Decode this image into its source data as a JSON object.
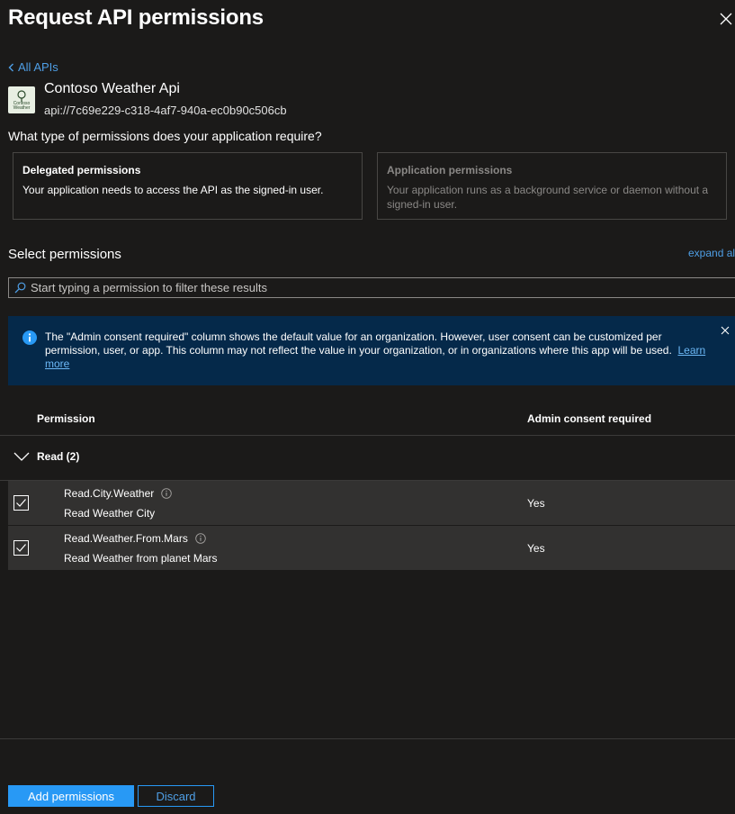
{
  "panel": {
    "title": "Request API permissions"
  },
  "nav": {
    "back_label": "All APIs"
  },
  "api": {
    "logo_text": "Contoso Weather",
    "name": "Contoso Weather Api",
    "id": "api://7c69e229-c318-4af7-940a-ec0b90c506cb"
  },
  "permission_type": {
    "question": "What type of permissions does your application require?",
    "delegated": {
      "title": "Delegated permissions",
      "description": "Your application needs to access the API as the signed-in user."
    },
    "application": {
      "title": "Application permissions",
      "description": "Your application runs as a background service or daemon without a signed-in user."
    }
  },
  "select": {
    "label": "Select permissions",
    "expand_label": "expand all",
    "filter_placeholder": "Start typing a permission to filter these results"
  },
  "banner": {
    "text": "The \"Admin consent required\" column shows the default value for an organization. However, user consent can be customized per permission, user, or app. This column may not reflect the value in your organization, or in organizations where this app will be used.",
    "link": "Learn more"
  },
  "table": {
    "headers": {
      "permission": "Permission",
      "admin_consent": "Admin consent required"
    },
    "group": {
      "label": "Read (2)"
    },
    "rows": [
      {
        "name": "Read.City.Weather",
        "description": "Read Weather City",
        "admin_consent": "Yes",
        "checked": true
      },
      {
        "name": "Read.Weather.From.Mars",
        "description": "Read Weather from planet Mars",
        "admin_consent": "Yes",
        "checked": true
      }
    ]
  },
  "footer": {
    "add_label": "Add permissions",
    "discard_label": "Discard"
  },
  "colors": {
    "background": "#1b1a19",
    "accent": "#2899f5",
    "link": "#4f9fe6",
    "banner": "#05294a",
    "row_selected": "#323130"
  }
}
